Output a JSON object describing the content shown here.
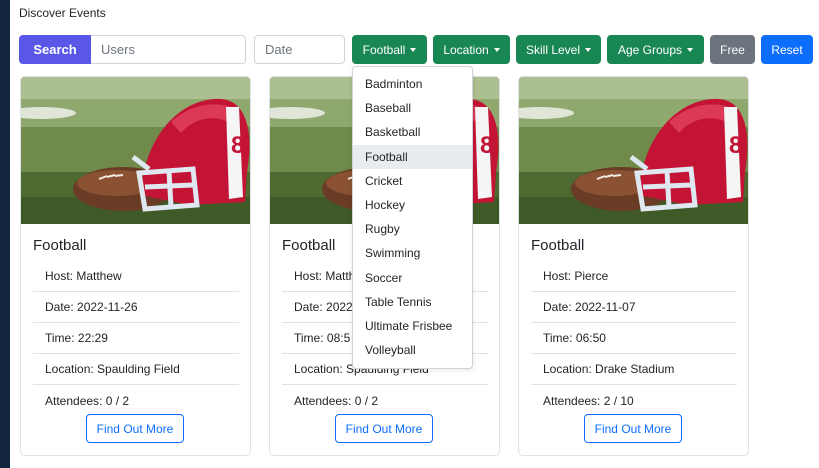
{
  "page": {
    "title": "Discover Events"
  },
  "search": {
    "button_label": "Search",
    "users_placeholder": "Users",
    "date_placeholder": "Date"
  },
  "filters": [
    {
      "label": "Football",
      "has_caret": true,
      "color": "#198754"
    },
    {
      "label": "Location",
      "has_caret": true,
      "color": "#198754"
    },
    {
      "label": "Skill Level",
      "has_caret": true,
      "color": "#198754"
    },
    {
      "label": "Age Groups",
      "has_caret": true,
      "color": "#198754"
    },
    {
      "label": "Free",
      "has_caret": false,
      "color": "#6c757d"
    },
    {
      "label": "Reset",
      "has_caret": false,
      "color": "#0d6efd"
    }
  ],
  "sport_dropdown": {
    "open": true,
    "selected": "Football",
    "options": [
      "Badminton",
      "Baseball",
      "Basketball",
      "Football",
      "Cricket",
      "Hockey",
      "Rugby",
      "Swimming",
      "Soccer",
      "Table Tennis",
      "Ultimate Frisbee",
      "Volleyball"
    ]
  },
  "events": [
    {
      "sport": "Football",
      "host": "Host: Matthew",
      "date": "Date: 2022-11-26",
      "time": "Time: 22:29",
      "location": "Location: Spaulding Field",
      "attendees": "Attendees: 0 / 2",
      "button": "Find Out More"
    },
    {
      "sport": "Football",
      "host": "Host: Matth",
      "date": "Date: 2022",
      "time": "Time: 08:5",
      "location": "Location: Spaulding Field",
      "attendees": "Attendees: 0 / 2",
      "button": "Find Out More"
    },
    {
      "sport": "Football",
      "host": "Host: Pierce",
      "date": "Date: 2022-11-07",
      "time": "Time: 06:50",
      "location": "Location: Drake Stadium",
      "attendees": "Attendees: 2 / 10",
      "button": "Find Out More"
    }
  ],
  "theme": {
    "search_button": "#5b57e6",
    "filter_green": "#198754",
    "link_blue": "#0d6efd",
    "outer_background": "#11253f"
  }
}
